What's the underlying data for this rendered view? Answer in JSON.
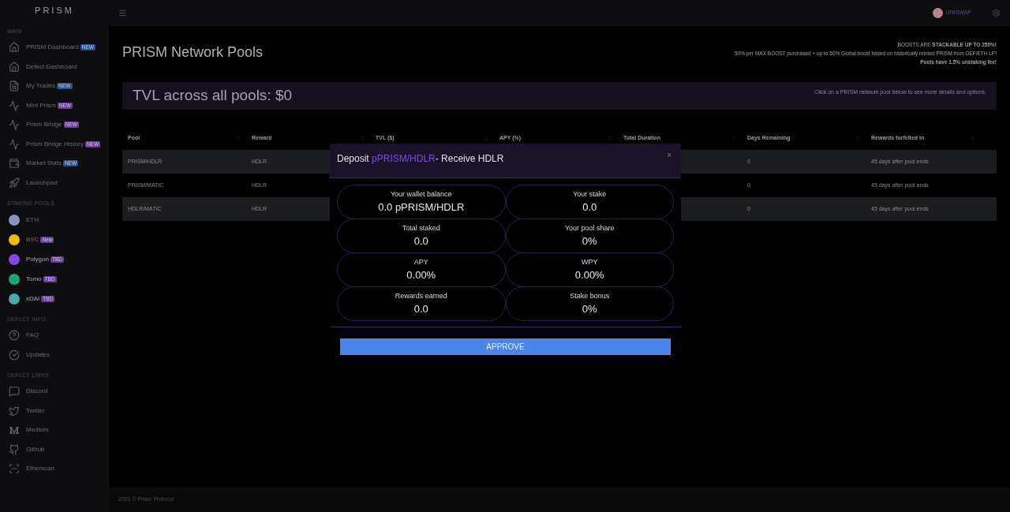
{
  "brand": "PRISM",
  "sidebar": {
    "sections": [
      {
        "title": "MAIN",
        "items": [
          {
            "label": "PRISM Dashboard",
            "badge": {
              "text": "NEW",
              "color": "#2b4f8f"
            }
          },
          {
            "label": "Defect Dashboard"
          },
          {
            "label": "My Trades",
            "badge": {
              "text": "NEW",
              "color": "#2b4f8f"
            }
          },
          {
            "label": "Mint Prism",
            "badge": {
              "text": "NEW",
              "color": "#6a3c9c"
            }
          },
          {
            "label": "Prism Bridge",
            "badge": {
              "text": "NEW",
              "color": "#6a3c9c"
            }
          },
          {
            "label": "Prism Bridge History",
            "badge": {
              "text": "NEW",
              "color": "#6a3c9c"
            }
          },
          {
            "label": "Market Stats",
            "badge": {
              "text": "NEW",
              "color": "#2b4f8f"
            }
          },
          {
            "label": "Launchpad"
          }
        ]
      },
      {
        "title": "STAKING POOLS",
        "items": [
          {
            "label": "ETH"
          },
          {
            "label": "BSC",
            "badge": {
              "text": "New",
              "color": "#6a3c9c"
            }
          },
          {
            "label": "Polygon",
            "badge": {
              "text": "TBD",
              "color": "#6a3c9c"
            }
          },
          {
            "label": "Tomo",
            "badge": {
              "text": "TBD",
              "color": "#6a3c9c"
            }
          },
          {
            "label": "xDAI",
            "badge": {
              "text": "TBD",
              "color": "#6a3c9c"
            }
          }
        ]
      },
      {
        "title": "DEFLCT INFO",
        "items": [
          {
            "label": "FAQ"
          },
          {
            "label": "Updates"
          }
        ]
      },
      {
        "title": "DEFLCT LINKS",
        "items": [
          {
            "label": "Discord"
          },
          {
            "label": "Twitter"
          },
          {
            "label": "Medium"
          },
          {
            "label": "Github"
          },
          {
            "label": "Etherscan"
          }
        ]
      }
    ]
  },
  "topbar": {
    "exchange": "UNISWAP"
  },
  "page": {
    "title": "PRISM Network Pools",
    "notes": [
      "BOOSTS ARE **STACKABLE UP TO 250%!**",
      "50% per MAX BOOST purchased + up to 50% Global boost based on historically minted PRISM from DEF/ETH LP!",
      "Pools have 1.5% unstaking fee!"
    ],
    "tvl": "TVL across all pools: $0",
    "hint": "Click on a PRISM network pool below to see more details and options."
  },
  "table": {
    "columns": [
      "Pool",
      "Reward",
      "TVL ($)",
      "APY (%)",
      "Total Duration",
      "Days Remaining",
      "Rewards forfeited in"
    ],
    "rows": [
      {
        "pool": "PRISM/HDLR",
        "reward": "HDLR",
        "days_remaining": "0",
        "rewards_forfeited": "45 days after pool ends"
      },
      {
        "pool": "PRISM/MATIC",
        "reward": "HDLR",
        "days_remaining": "0",
        "rewards_forfeited": "45 days after pool ends"
      },
      {
        "pool": "HDLR/MATIC",
        "reward": "HDLR",
        "days_remaining": "0",
        "rewards_forfeited": "45 days after pool ends"
      }
    ]
  },
  "modal": {
    "title_prefix": "Deposit",
    "title_token": "pPRISM/HDLR",
    "title_suffix": "- Receive HDLR",
    "close": "×",
    "stats": [
      {
        "label": "Your wallet balance",
        "value": "0.0 pPRISM/HDLR"
      },
      {
        "label": "Your stake",
        "value": "0.0"
      },
      {
        "label": "Total staked",
        "value": "0.0"
      },
      {
        "label": "Your pool share",
        "value": "0%"
      },
      {
        "label": "APY",
        "value": "0.00%"
      },
      {
        "label": "WPY",
        "value": "0.00%"
      },
      {
        "label": "Rewards earned",
        "value": "0.0"
      },
      {
        "label": "Stake bonus",
        "value": "0%"
      }
    ],
    "button": "APPROVE"
  },
  "footer": "2021 © Prism Protocol"
}
